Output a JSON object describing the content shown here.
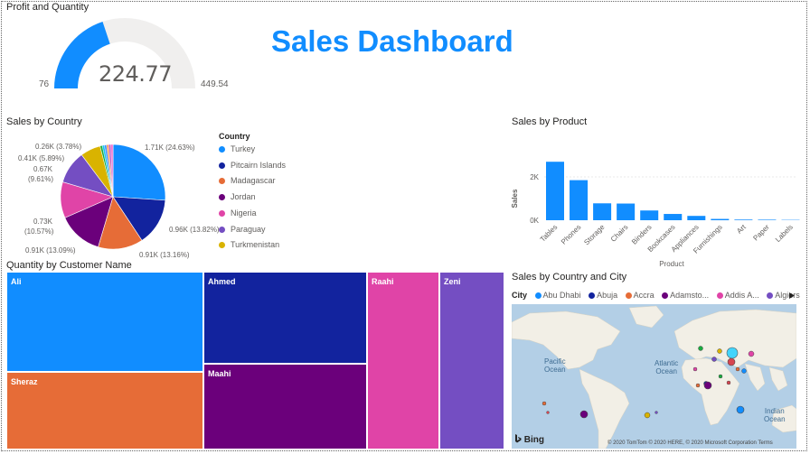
{
  "dashboard_title": "Sales Dashboard",
  "accent_color": "#118DFF",
  "gauge": {
    "title": "Profit and Quantity",
    "value": "224.77",
    "min": "76",
    "max": "449.54",
    "value_num": 224.77,
    "min_num": 76,
    "max_num": 449.54
  },
  "sales_by_country": {
    "title": "Sales by Country",
    "legend_title": "Country",
    "legend": [
      {
        "name": "Turkey",
        "color": "#118DFF"
      },
      {
        "name": "Pitcairn Islands",
        "color": "#12239E"
      },
      {
        "name": "Madagascar",
        "color": "#E66C37"
      },
      {
        "name": "Jordan",
        "color": "#6B007B"
      },
      {
        "name": "Nigeria",
        "color": "#E044A7"
      },
      {
        "name": "Paraguay",
        "color": "#744EC2"
      },
      {
        "name": "Turkmenistan",
        "color": "#D9B300"
      }
    ],
    "labels": {
      "turkey": "1.71K (24.63%)",
      "pitcairn": "0.96K (13.82%)",
      "madagascar": "0.91K (13.16%)",
      "jordan": "0.91K (13.09%)",
      "nigeria_value": "0.73K",
      "nigeria_pct": "(10.57%)",
      "paraguay_value": "0.67K",
      "paraguay_pct": "(9.61%)",
      "turkmenistan": "0.41K (5.89%)",
      "other": "0.26K (3.78%)"
    }
  },
  "sales_by_product": {
    "title": "Sales by Product",
    "xlabel": "Product",
    "ylabel": "Sales",
    "ticks": [
      "2K",
      "0K"
    ]
  },
  "quantity_by_customer": {
    "title": "Quantity by Customer Name",
    "cells": [
      {
        "name": "Ali",
        "color": "#118DFF"
      },
      {
        "name": "Sheraz",
        "color": "#E66C37"
      },
      {
        "name": "Ahmed",
        "color": "#12239E"
      },
      {
        "name": "Maahi",
        "color": "#6B007B"
      },
      {
        "name": "Raahi",
        "color": "#E044A7"
      },
      {
        "name": "Zeni",
        "color": "#744EC2"
      }
    ]
  },
  "map": {
    "title": "Sales by Country and City",
    "legend_label": "City",
    "legend": [
      {
        "name": "Abu Dhabi",
        "color": "#118DFF"
      },
      {
        "name": "Abuja",
        "color": "#12239E"
      },
      {
        "name": "Accra",
        "color": "#E66C37"
      },
      {
        "name": "Adamsto...",
        "color": "#6B007B"
      },
      {
        "name": "Addis A...",
        "color": "#E044A7"
      },
      {
        "name": "Algiers",
        "color": "#744EC2"
      }
    ],
    "oceans": {
      "pacific_1": "Pacific",
      "pacific_2": "Ocean",
      "atlantic_1": "Atlantic",
      "atlantic_2": "Ocean",
      "indian_1": "Indian",
      "indian_2": "Ocean"
    },
    "provider": "Bing",
    "copyright": "© 2020 TomTom © 2020 HERE, © 2020 Microsoft Corporation Terms"
  },
  "chart_data": [
    {
      "type": "pie",
      "title": "Sales by Country",
      "categories": [
        "Turkey",
        "Pitcairn Islands",
        "Madagascar",
        "Jordan",
        "Nigeria",
        "Paraguay",
        "Turkmenistan",
        "Other"
      ],
      "values": [
        1.71,
        0.96,
        0.91,
        0.91,
        0.73,
        0.67,
        0.41,
        0.26
      ],
      "percentages": [
        24.63,
        13.82,
        13.16,
        13.09,
        10.57,
        9.61,
        5.89,
        3.78
      ],
      "colors": [
        "#118DFF",
        "#12239E",
        "#E66C37",
        "#6B007B",
        "#E044A7",
        "#744EC2",
        "#D9B300",
        "#D64550"
      ]
    },
    {
      "type": "bar",
      "title": "Sales by Product",
      "categories": [
        "Tables",
        "Phones",
        "Storage",
        "Chairs",
        "Binders",
        "Bookcases",
        "Appliances",
        "Furnishings",
        "Art",
        "Paper",
        "Labels"
      ],
      "values": [
        2700,
        1850,
        780,
        770,
        450,
        290,
        200,
        60,
        30,
        25,
        15
      ],
      "xlabel": "Product",
      "ylabel": "Sales",
      "ylim": [
        0,
        3000
      ],
      "yticks": [
        "0K",
        "2K"
      ],
      "color": "#118DFF"
    }
  ]
}
